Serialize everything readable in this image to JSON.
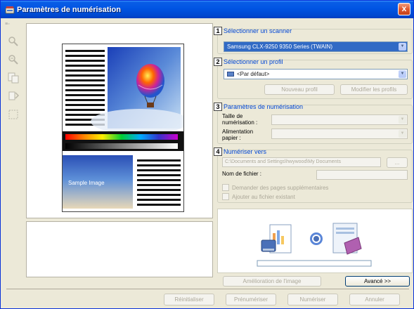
{
  "window": {
    "title": "Paramètres de numérisation",
    "close_label": "x"
  },
  "menu": {
    "tag": "≡◦"
  },
  "toolbar": {
    "tools": [
      {
        "name": "zoom-in-icon"
      },
      {
        "name": "zoom-out-icon"
      },
      {
        "name": "fit-page-icon"
      },
      {
        "name": "rotate-icon"
      },
      {
        "name": "select-area-icon"
      }
    ]
  },
  "preview": {
    "sample_label": "Sample Image"
  },
  "section1": {
    "num": "1",
    "title": "Sélectionner un scanner",
    "scanner_value": "Samsung CLX-9250 9350 Series (TWAIN)"
  },
  "section2": {
    "num": "2",
    "title": "Sélectionner un profil",
    "profile_value": "<Par défaut>",
    "new_profile": "Nouveau profil",
    "edit_profiles": "Modifier les profils"
  },
  "section3": {
    "num": "3",
    "title": "Paramètres de numérisation",
    "scan_size_label": "Taille de numérisation :",
    "feed_label": "Alimentation papier :"
  },
  "section4": {
    "num": "4",
    "title": "Numériser vers",
    "path_value": "C:\\Documents and Settings\\hwywood\\My Documents",
    "browse_label": "...",
    "filename_label": "Nom de fichier :",
    "ask_more_pages": "Demander des pages supplémentaires",
    "add_to_file": "Ajouter au fichier existant"
  },
  "actions": {
    "image_enhancement": "Amélioration de l'image",
    "advanced": "Avancé >>"
  },
  "footer": {
    "reset": "Réinitialiser",
    "prescan": "Prénumériser",
    "scan": "Numériser",
    "cancel": "Annuler"
  },
  "colors": {
    "title_bar": "#0054e3",
    "accent": "#316ac5",
    "group_title": "#0046d5"
  }
}
